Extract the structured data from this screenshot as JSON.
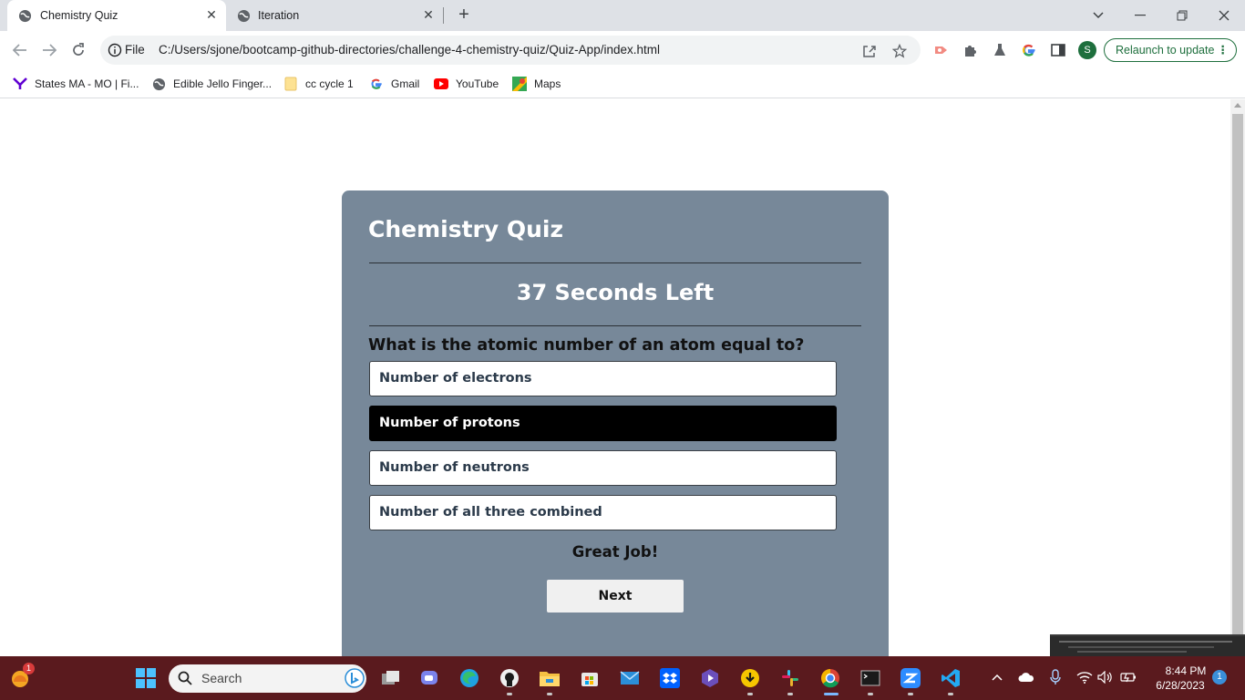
{
  "browser": {
    "tabs": [
      {
        "title": "Chemistry Quiz",
        "active": true
      },
      {
        "title": "Iteration",
        "active": false
      }
    ],
    "new_tab": "+",
    "omnibox": {
      "scheme_label": "File",
      "url": "C:/Users/sjone/bootcamp-github-directories/challenge-4-chemistry-quiz/Quiz-App/index.html"
    },
    "profile_initial": "S",
    "relaunch_label": "Relaunch to update",
    "bookmarks": [
      {
        "label": "States MA - MO | Fi...",
        "icon": "yahoo-icon"
      },
      {
        "label": "Edible Jello Finger...",
        "icon": "globe-icon"
      },
      {
        "label": "cc cycle 1",
        "icon": "folder-icon"
      },
      {
        "label": "Gmail",
        "icon": "google-icon"
      },
      {
        "label": "YouTube",
        "icon": "youtube-icon"
      },
      {
        "label": "Maps",
        "icon": "maps-icon"
      }
    ]
  },
  "quiz": {
    "title": "Chemistry Quiz",
    "timer": "37 Seconds Left",
    "question": "What is the atomic number of an atom equal to?",
    "answers": [
      {
        "label": "Number of electrons",
        "selected": false
      },
      {
        "label": "Number of protons",
        "selected": true
      },
      {
        "label": "Number of neutrons",
        "selected": false
      },
      {
        "label": "Number of all three combined",
        "selected": false
      }
    ],
    "feedback": "Great Job!",
    "next_label": "Next",
    "colors": {
      "card": "#778899",
      "selected": "#000000"
    }
  },
  "taskbar": {
    "search_placeholder": "Search",
    "weather_badge": "1",
    "time": "8:44 PM",
    "date": "6/28/2023",
    "notification_count": "1",
    "colors": {
      "background": "#5a1a1e"
    }
  }
}
